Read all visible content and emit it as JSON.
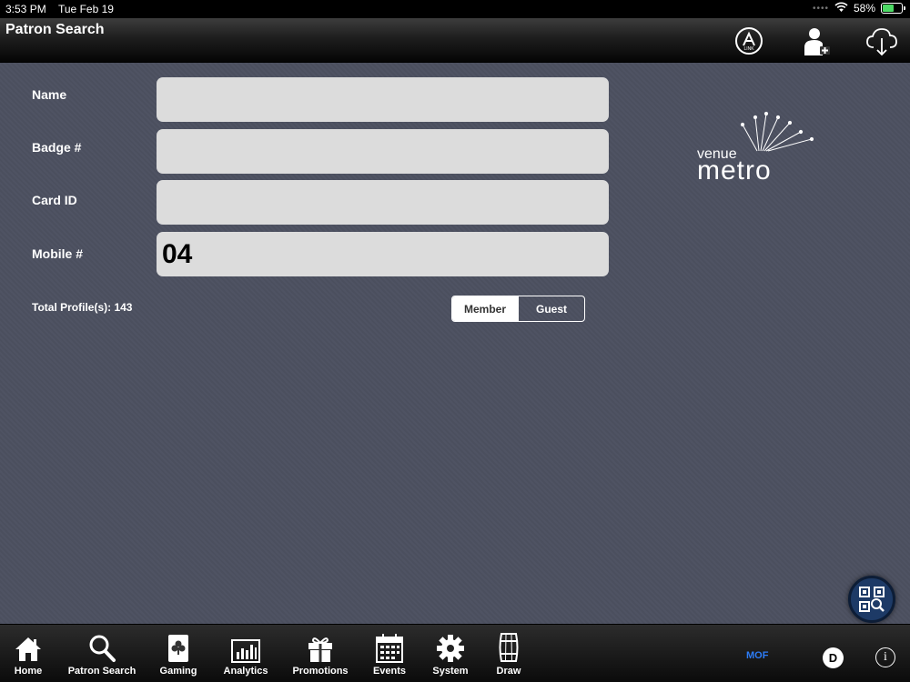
{
  "status_bar": {
    "time": "3:53 PM",
    "date": "Tue Feb 19",
    "battery": "58%",
    "battery_level": 0.58
  },
  "nav": {
    "title": "Patron Search",
    "icons": [
      "link-icon",
      "add-patron-icon",
      "cloud-download-icon"
    ]
  },
  "form": {
    "name": {
      "label": "Name",
      "value": ""
    },
    "badge": {
      "label": "Badge #",
      "value": ""
    },
    "card_id": {
      "label": "Card ID",
      "value": ""
    },
    "mobile": {
      "label": "Mobile #",
      "value": "04"
    }
  },
  "total_profiles": "Total Profile(s): 143",
  "segment": {
    "options": [
      "Member",
      "Guest"
    ],
    "selected": "Member"
  },
  "logo": {
    "line1": "venue",
    "line2": "metro"
  },
  "tabs": [
    {
      "label": "Home",
      "icon": "home-icon"
    },
    {
      "label": "Patron Search",
      "icon": "search-icon"
    },
    {
      "label": "Gaming",
      "icon": "card-club-icon"
    },
    {
      "label": "Analytics",
      "icon": "bar-chart-icon"
    },
    {
      "label": "Promotions",
      "icon": "gift-icon"
    },
    {
      "label": "Events",
      "icon": "calendar-icon"
    },
    {
      "label": "System",
      "icon": "gear-icon"
    },
    {
      "label": "Draw",
      "icon": "barrel-icon"
    }
  ],
  "footer": {
    "mof": "MOF",
    "d_badge": "D",
    "info": "i"
  },
  "colors": {
    "background": "#4d5160",
    "input_fill": "#dcdcdc",
    "accent_blue": "#2d7cf6",
    "qr_button": "#1d3a66"
  }
}
